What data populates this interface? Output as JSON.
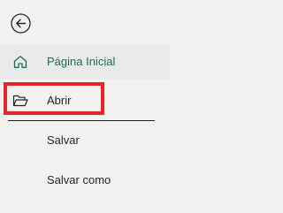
{
  "nav": {
    "back_icon": "back-arrow-icon",
    "items": [
      {
        "label": "Página Inicial",
        "icon": "home-icon",
        "selected": true,
        "color": "#1e6b4b"
      },
      {
        "label": "Abrir",
        "icon": "folder-open-icon",
        "highlighted": true
      },
      {
        "label": "Salvar"
      },
      {
        "label": "Salvar como"
      }
    ]
  },
  "colors": {
    "accent": "#1e6b4b",
    "highlight": "#e8262a",
    "background": "#f3f2f1"
  }
}
